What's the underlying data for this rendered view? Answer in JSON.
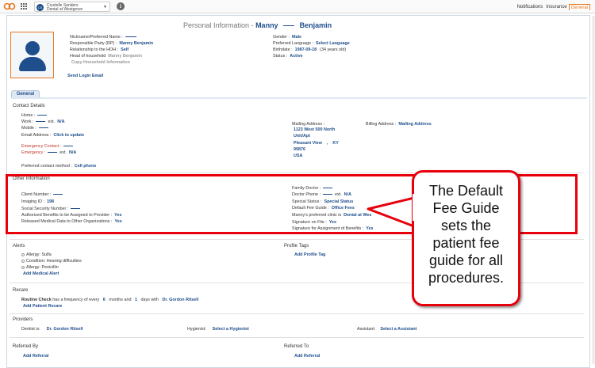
{
  "topbar": {
    "avatar_initials": "CS",
    "user_name": "Crystelle Sanders",
    "office": "Dental at Westgrove",
    "tabs": [
      {
        "label": "Notifications",
        "active": false
      },
      {
        "label": "Insurance",
        "active": false
      },
      {
        "label": "General",
        "active": true
      }
    ]
  },
  "header": {
    "prefix": "Personal Information -",
    "first_name": "Manny",
    "last_name": "Benjamin"
  },
  "personal": {
    "nickname_label": "Nickname/Preferred Name :",
    "rp_label": "Responsible Party (RP) :",
    "rp_value": "Manny Benjamin",
    "relationship_label": "Relationship to the HOH :",
    "relationship_value": "Self",
    "hoh_label": "Head of household",
    "hoh_value": "Manny Benjamin",
    "copy_hoh": "Copy Household Information",
    "send_login": "Send Login Email",
    "gender_label": "Gender :",
    "gender_value": "Male",
    "language_label": "Preferred Language :",
    "language_value": "Select Language",
    "birthdate_label": "Birthdate :",
    "birthdate_value": "1987-09-18",
    "age": "(34 years old)",
    "status_label": "Status :",
    "status_value": "Active"
  },
  "section_tab": "General",
  "contact": {
    "title": "Contact Details",
    "home_label": "Home :",
    "work_label": "Work :",
    "ext_label": "ext.",
    "work_ext": "N/A",
    "mobile_label": "Mobile :",
    "email_label": "Email Address :",
    "email_value": "Click to update",
    "emergency_contact_label": "Emergency Contact :",
    "emergency_label": "Emergency :",
    "emergency_ext": "N/A",
    "preferred_label": "Preferred contact method :",
    "preferred_value": "Cell phone",
    "mailing_label": "Mailing Address :",
    "mailing_lines": [
      "1123 West 500 North",
      "Unit/Apt",
      "Pleasant View    ,    KY",
      "99876",
      "USA"
    ],
    "billing_label": "Billing Address :",
    "billing_value": "Mailing Address"
  },
  "other": {
    "title": "Other Information",
    "client_label": "Client Number :",
    "imaging_label": "Imaging ID :",
    "imaging_value": "198",
    "ssn_label": "Social Security Number :",
    "authorized_label": "Authorized Benefits to be Assigned to Provider :",
    "authorized_value": "Yes",
    "released_label": "Released Medical Data to Other Organizations :",
    "released_value": "Yes",
    "family_doctor_label": "Family Doctor :",
    "doctor_phone_label": "Doctor Phone :",
    "doctor_ext_label": "ext.",
    "doctor_ext": "N/A",
    "special_label": "Special Status :",
    "special_value": "Special Status",
    "fee_label": "Default Fee Guide :",
    "fee_value": "Office Fees",
    "clinic_label": "Manny's preferred clinic is",
    "clinic_value": "Dental at Wes",
    "sig_file_label": "Signature on File :",
    "sig_file_value": "Yes",
    "sig_benefits_label": "Signature for Assignment of Benefits :",
    "sig_benefits_value": "Yes"
  },
  "alerts": {
    "title": "Alerts",
    "items": [
      "Allergy: Sulfa",
      "Condition: Hearing difficulties",
      "Allergy: Penicillin"
    ],
    "add": "Add Medical Alert"
  },
  "profile_tags": {
    "title": "Profile Tags",
    "add": "Add Profile Tag"
  },
  "recare": {
    "title": "Recare",
    "item_name": "Routine Check",
    "text1": "has a frequency of every",
    "months": "6",
    "text2": "months and",
    "days": "1",
    "text3": "days with",
    "doctor": "Dr. Gordon Ritsell",
    "add": "Add Patient Recare"
  },
  "providers": {
    "title": "Providers",
    "dentist_label": "Dentist is:",
    "dentist_value": "Dr. Gordon Ritsell",
    "hygienist_label": "Hygienist:",
    "hygienist_value": "Select a Hygienist",
    "assistant_label": "Assistant:",
    "assistant_value": "Select a Assistant"
  },
  "referred_by": {
    "title": "Referred By",
    "add": "Add Referral"
  },
  "referred_to": {
    "title": "Referred To",
    "add": "Add Referral"
  },
  "callout": {
    "lines": [
      "The Default",
      "Fee Guide",
      "sets the",
      "patient fee",
      "guide for all",
      "procedures."
    ]
  },
  "colors": {
    "accent": "#e8781e",
    "link": "#1f4e8c",
    "callout_border": "#e8000b"
  }
}
